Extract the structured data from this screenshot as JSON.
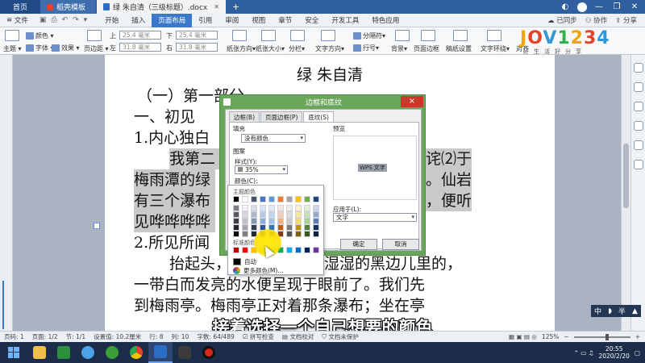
{
  "tabbar": {
    "home_tab": "首页",
    "template_tab": "稻壳模板",
    "doc_tab": "绿 朱自清（三级标题）.docx",
    "add": "+"
  },
  "menubar": {
    "file": "文件",
    "items": [
      "开始",
      "插入",
      "页面布局",
      "引用",
      "审阅",
      "视图",
      "章节",
      "安全",
      "开发工具",
      "特色应用"
    ],
    "active_index": 2,
    "synced": "已同步",
    "collab": "协作",
    "share": "分享"
  },
  "ribbon": {
    "theme": "主题",
    "colors": "颜色",
    "fonts": "字体",
    "effects": "效果",
    "margins": "页边距",
    "top_label": "上",
    "top_value": "25.4 毫米",
    "bottom_label": "下",
    "bottom_value": "25.4 毫米",
    "left_label": "左",
    "left_value": "31.8 毫米",
    "right_label": "右",
    "right_value": "31.8 毫米",
    "orientation": "纸张方向",
    "size": "纸张大小",
    "columns": "分栏",
    "text_direction": "文字方向",
    "breaks": "分隔符",
    "line_numbers": "行号",
    "background": "背景",
    "page_border": "页面边框",
    "draft_paper": "稿纸设置",
    "wrap": "文字环绕",
    "align": "对齐"
  },
  "logo": {
    "main": [
      "J",
      "O",
      "V",
      "1",
      "2",
      "3",
      "4"
    ],
    "sub": "好生活好分享"
  },
  "document": {
    "title": "绿  朱自清",
    "lines": [
      "（一）第一部分",
      "一、初见",
      "1.内心独白",
      "我第二",
      "梅雨潭的绿",
      "有三个瀑布",
      "见哗哗哗哗",
      "2.所见所闻",
      "抬起头，",
      "一带白而发亮的水便呈现于眼前了。我们先",
      "到梅雨亭。梅雨亭正对着那条瀑布；坐在亭"
    ],
    "right_fragments": {
      "line3": "诧⑵于",
      "line4": "。仙岩",
      "line5": "，便听"
    },
    "line8_tail": "湿湿的黑边儿里的，"
  },
  "dialog": {
    "title": "边框和底纹",
    "close": "×",
    "tabs": [
      "边框(B)",
      "页面边框(P)",
      "底纹(S)"
    ],
    "selected_tab": 2,
    "fill_label": "填充",
    "fill_value": "没有颜色",
    "pattern_label": "图案",
    "style_label": "样式(Y):",
    "style_value": "35%",
    "color_label": "颜色(C):",
    "color_value": "自动",
    "preview_label": "预览",
    "preview_text": "WPS 文字",
    "apply_label": "应用于(L):",
    "apply_value": "文字",
    "ok": "确定",
    "cancel": "取消"
  },
  "color_popup": {
    "theme_colors_label": "主题颜色",
    "standard_colors_label": "标准颜色",
    "auto": "自动",
    "more_colors": "更多颜色(M)...",
    "theme_top_row": [
      "#000000",
      "#ffffff",
      "#44546a",
      "#4472c4",
      "#5b9bd5",
      "#ed7d31",
      "#a5a5a5",
      "#ffc000",
      "#70ad47",
      "#264478"
    ],
    "theme_shades": [
      [
        "#7f7f7f",
        "#f2f2f2",
        "#d6dce5",
        "#dae3f3",
        "#deebf7",
        "#fbe5d6",
        "#ededed",
        "#fff2cc",
        "#e2f0d9",
        "#c9d3e8"
      ],
      [
        "#595959",
        "#d9d9d9",
        "#adb9ca",
        "#b4c7e7",
        "#bdd7ee",
        "#f8cbad",
        "#dbdbdb",
        "#ffe699",
        "#c5e0b4",
        "#94a8d1"
      ],
      [
        "#3f3f3f",
        "#bfbfbf",
        "#8497b0",
        "#8faadc",
        "#9dc3e6",
        "#f4b183",
        "#c9c9c9",
        "#ffd966",
        "#a9d18e",
        "#5f7dba"
      ],
      [
        "#262626",
        "#a6a6a6",
        "#333f50",
        "#2f5597",
        "#2e75b6",
        "#c55a11",
        "#7b7b7b",
        "#bf9000",
        "#548235",
        "#1c3359"
      ],
      [
        "#0d0d0d",
        "#808080",
        "#222a35",
        "#203864",
        "#1f4e79",
        "#843c0c",
        "#525252",
        "#7f6000",
        "#385723",
        "#13223b"
      ]
    ],
    "standard": [
      "#c00000",
      "#ff0000",
      "#ffc000",
      "#ffff00",
      "#92d050",
      "#00b050",
      "#00b0f0",
      "#0070c0",
      "#002060",
      "#7030a0"
    ]
  },
  "subtitle": "接着选择一个自己想要的颜色",
  "ime": {
    "lang": "中",
    "mode": "半"
  },
  "statusbar": {
    "page": "页码: 1",
    "pages": "页面: 1/2",
    "section": "节: 1/1",
    "setting": "设置值: 10.2厘米",
    "row": "行: 8",
    "col": "列: 10",
    "words": "字数: 64/489",
    "spell": "拼写检查",
    "doc_check": "文档校对",
    "protect": "文档未保护",
    "zoom": "125%",
    "zoom_level": 0.6,
    "minus": "−",
    "plus": "+"
  },
  "taskbar": {
    "time": "20:55",
    "date": "2020/2/20",
    "active_index": 6
  }
}
